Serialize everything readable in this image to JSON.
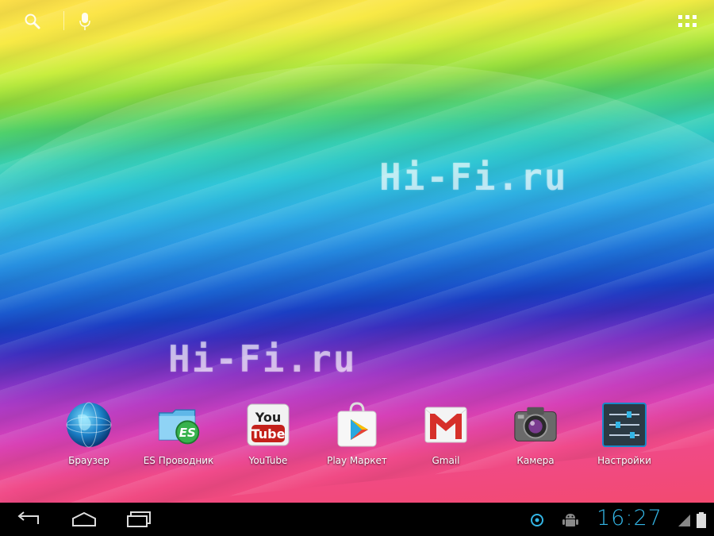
{
  "wallpaper": {
    "watermarks": [
      "Hi-Fi.ru",
      "Hi-Fi.ru"
    ]
  },
  "topbar": {
    "search_icon": "search-icon",
    "mic_icon": "microphone-icon",
    "apps_icon": "all-apps-grid-icon"
  },
  "dock": {
    "apps": [
      {
        "label": "Браузер",
        "icon": "browser-globe-icon"
      },
      {
        "label": "ES Проводник",
        "icon": "es-file-explorer-icon"
      },
      {
        "label": "YouTube",
        "icon": "youtube-icon"
      },
      {
        "label": "Play Маркет",
        "icon": "play-store-icon"
      },
      {
        "label": "Gmail",
        "icon": "gmail-icon"
      },
      {
        "label": "Камера",
        "icon": "camera-icon"
      },
      {
        "label": "Настройки",
        "icon": "settings-icon"
      }
    ]
  },
  "navbar": {
    "buttons": [
      "back-icon",
      "home-icon",
      "recent-apps-icon"
    ],
    "status_icons": [
      "sync-icon",
      "android-debug-icon",
      "signal-icon",
      "battery-icon"
    ],
    "clock": "16:27",
    "clock_color": "#33b5e5"
  }
}
